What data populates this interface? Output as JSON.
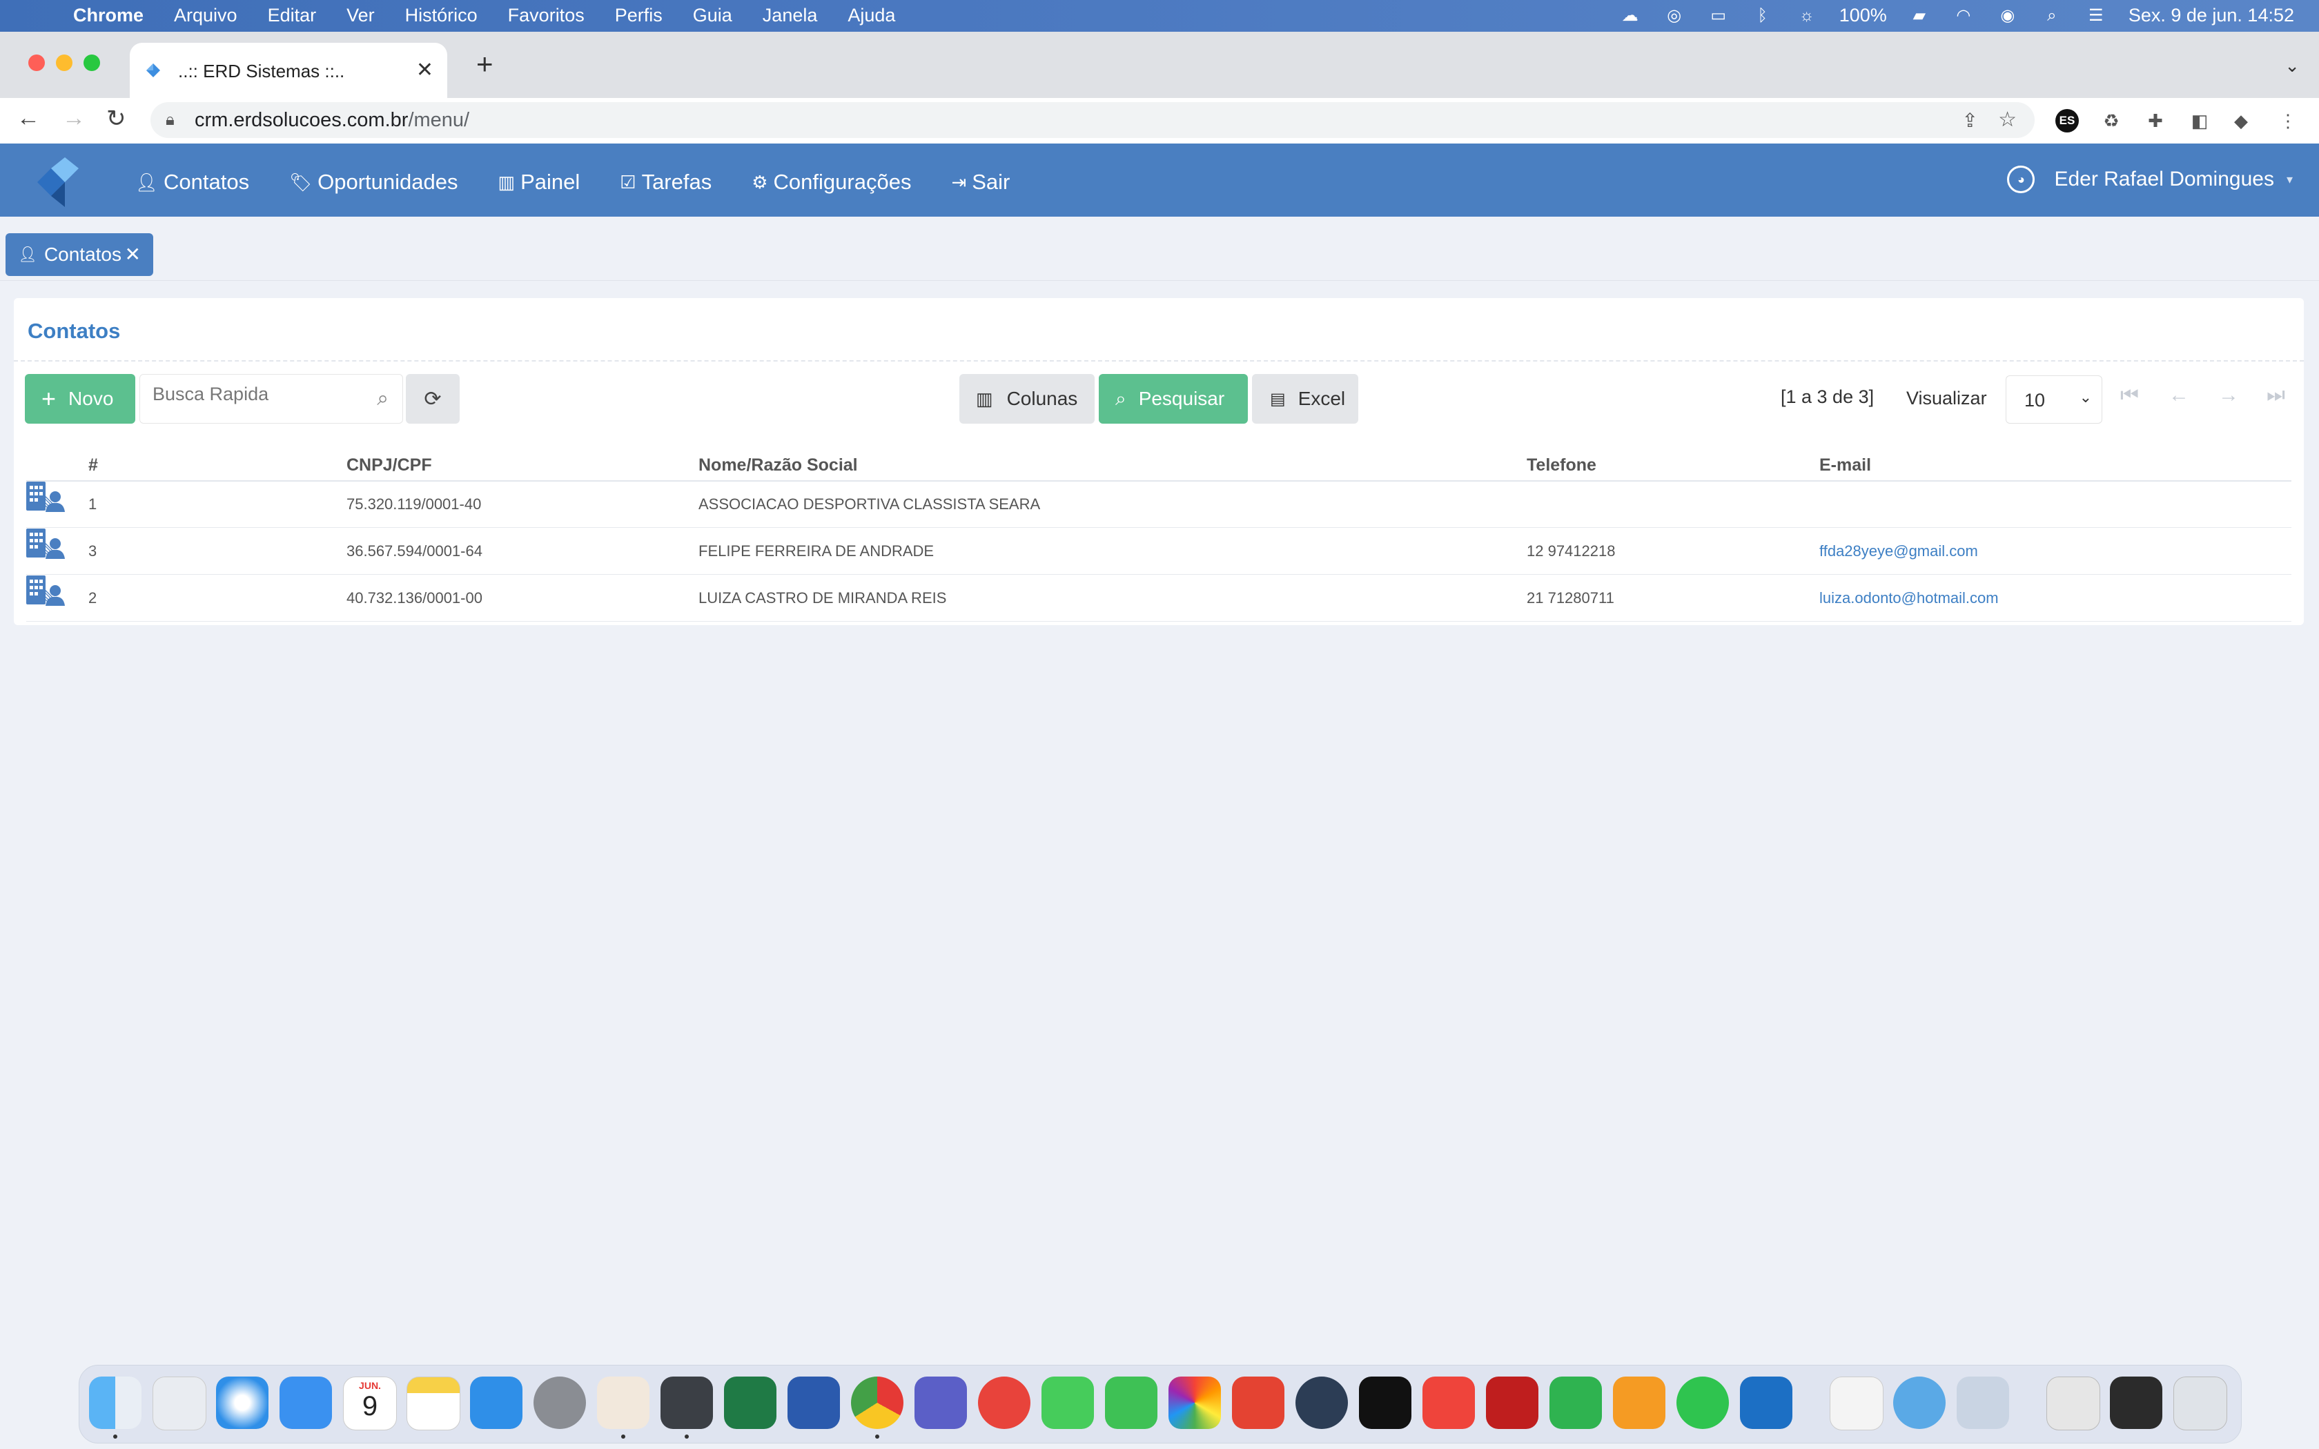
{
  "menubar": {
    "app_name": "Chrome",
    "items": [
      "Arquivo",
      "Editar",
      "Ver",
      "Histórico",
      "Favoritos",
      "Perfis",
      "Guia",
      "Janela",
      "Ajuda"
    ],
    "battery": "100%",
    "datetime": "Sex. 9 de jun.  14:52"
  },
  "browser": {
    "tab_title": "..:: ERD Sistemas ::..",
    "url_host": "crm.erdsolucoes.com.br",
    "url_path": "/menu/",
    "ext_es": "ES"
  },
  "appnav": {
    "items": [
      "Contatos",
      "Oportunidades",
      "Painel",
      "Tarefas",
      "Configurações",
      "Sair"
    ],
    "user_name": "Eder Rafael Domingues"
  },
  "apptab": {
    "label": "Contatos"
  },
  "panel": {
    "title": "Contatos",
    "novo_label": "Novo",
    "search_placeholder": "Busca Rapida",
    "colunas_label": "Colunas",
    "pesquisar_label": "Pesquisar",
    "excel_label": "Excel",
    "count": "[1 a 3 de 3]",
    "visualizar_label": "Visualizar",
    "page_size": "10"
  },
  "table": {
    "headers": [
      "#",
      "CNPJ/CPF",
      "Nome/Razão Social",
      "Telefone",
      "E-mail"
    ],
    "rows": [
      {
        "id": "1",
        "cnpj": "75.320.119/0001-40",
        "nome": "ASSOCIACAO DESPORTIVA CLASSISTA SEARA",
        "telefone": "",
        "email": ""
      },
      {
        "id": "3",
        "cnpj": "36.567.594/0001-64",
        "nome": "FELIPE FERREIRA DE ANDRADE",
        "telefone": "12 97412218",
        "email": "ffda28yeye@gmail.com"
      },
      {
        "id": "2",
        "cnpj": "40.732.136/0001-00",
        "nome": "LUIZA CASTRO DE MIRANDA REIS",
        "telefone": "21 71280711",
        "email": "luiza.odonto@hotmail.com"
      }
    ]
  },
  "dock": {
    "calendar_month": "JUN.",
    "calendar_day": "9",
    "apps": [
      "finder",
      "launchpad",
      "safari",
      "mail",
      "calendar",
      "notes",
      "app-store",
      "system-settings",
      "bear",
      "sublime",
      "excel",
      "word",
      "chrome",
      "teams",
      "anydesk",
      "messages",
      "facetime",
      "photos",
      "todoist",
      "quicktime",
      "apple-tv",
      "anydesk-red",
      "filezilla",
      "numbers",
      "pages",
      "whatsapp",
      "sap",
      "textedit",
      "migration",
      "preview",
      "archive",
      "terminal",
      "trash"
    ]
  },
  "colors": {
    "navbar": "#4a7fc1",
    "green_button": "#5cc08f",
    "link": "#3d7fc4"
  }
}
